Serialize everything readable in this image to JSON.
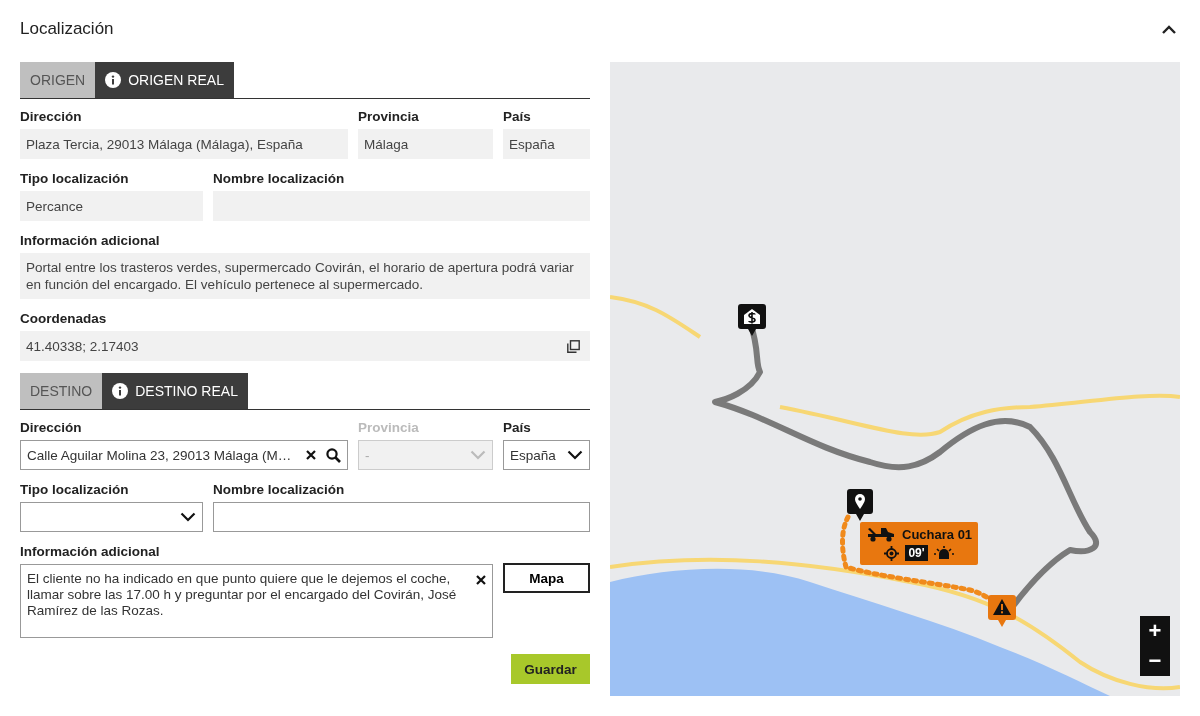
{
  "section": {
    "title": "Localización",
    "expanded": true
  },
  "origin": {
    "tabs": [
      {
        "label": "ORIGEN",
        "selected": false,
        "info": false
      },
      {
        "label": "ORIGEN REAL",
        "selected": true,
        "info": true
      }
    ],
    "rows": [
      {
        "fields": [
          {
            "label": "Dirección",
            "kind": "readonly",
            "value": "Plaza Tercia, 29013 Málaga (Málaga), España"
          },
          {
            "label": "Provincia",
            "kind": "readonly",
            "value": "Málaga"
          },
          {
            "label": "País",
            "kind": "readonly",
            "value": "España"
          }
        ]
      },
      {
        "fields": [
          {
            "label": "Tipo localización",
            "kind": "readonly",
            "value": "Percance"
          },
          {
            "label": "Nombre localización",
            "kind": "readonly"
          }
        ]
      },
      {
        "fields": [
          {
            "label": "Información adicional",
            "kind": "readonly",
            "value": "Portal entre los trasteros verdes, supermercado Covirán, el horario de apertura podrá variar en función del encargado. El vehículo pertenece al supermercado."
          }
        ]
      },
      {
        "fields": [
          {
            "label": "Coordenadas",
            "kind": "copy",
            "value": "41.40338; 2.17403"
          }
        ]
      }
    ]
  },
  "destination": {
    "tabs": [
      {
        "label": "DESTINO",
        "selected": false,
        "info": false
      },
      {
        "label": "DESTINO REAL",
        "selected": true,
        "info": true
      }
    ],
    "rows": [
      {
        "fields": [
          {
            "label": "Dirección",
            "kind": "search",
            "value": "Calle Aguilar Molina 23, 29013 Málaga (M…",
            "disabled": false
          },
          {
            "label": "Provincia",
            "kind": "select",
            "value": "-",
            "disabled": true
          },
          {
            "label": "País",
            "kind": "select",
            "value": "España",
            "disabled": false
          }
        ]
      },
      {
        "fields": [
          {
            "label": "Tipo localización",
            "kind": "select",
            "disabled": false
          },
          {
            "label": "Nombre localización",
            "kind": "text",
            "disabled": false
          }
        ]
      },
      {
        "fields": [
          {
            "label": "Información adicional",
            "kind": "textarea",
            "value": "El cliente no ha indicado en que punto quiere que le dejemos el coche, llamar sobre las 17.00 h y preguntar por el encargado del Covirán, José Ramírez de las Rozas.",
            "disabled": false
          }
        ],
        "button": "Mapa"
      }
    ]
  },
  "save_button": "Guardar",
  "map": {
    "vehicle": {
      "name": "Cuchara 01",
      "eta": "09'"
    },
    "zoom_in": "+",
    "zoom_out": "−"
  }
}
